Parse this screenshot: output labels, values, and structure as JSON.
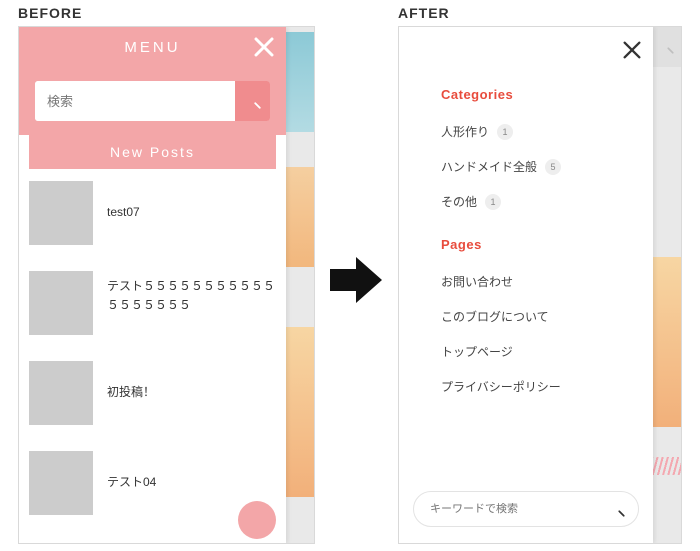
{
  "labels": {
    "before": "BEFORE",
    "after": "AFTER"
  },
  "before": {
    "menu_title": "MENU",
    "search_placeholder": "検索",
    "new_posts_heading": "New Posts",
    "posts": [
      {
        "title": "test07"
      },
      {
        "title": "テスト５５５５５５５５５５５５５５５５５５"
      },
      {
        "title": "初投稿！"
      },
      {
        "title": "テスト04"
      }
    ]
  },
  "after": {
    "sections": {
      "categories_title": "Categories",
      "pages_title": "Pages"
    },
    "categories": [
      {
        "label": "人形作り",
        "count": "1"
      },
      {
        "label": "ハンドメイド全般",
        "count": "5"
      },
      {
        "label": "その他",
        "count": "1"
      }
    ],
    "pages": [
      {
        "label": "お問い合わせ"
      },
      {
        "label": "このブログについて"
      },
      {
        "label": "トップページ"
      },
      {
        "label": "プライバシーポリシー"
      }
    ],
    "search_placeholder": "キーワードで検索"
  }
}
